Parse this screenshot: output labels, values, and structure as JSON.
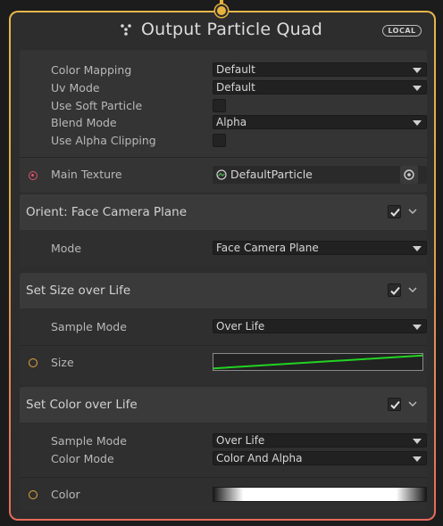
{
  "node": {
    "title": "Output Particle Quad",
    "badge": "LOCAL",
    "icon": "vfx-output-icon",
    "accent_color": "#e6b33e"
  },
  "main": {
    "properties": [
      {
        "label": "Color Mapping",
        "type": "dropdown",
        "value": "Default"
      },
      {
        "label": "Uv Mode",
        "type": "dropdown",
        "value": "Default"
      },
      {
        "label": "Use Soft Particle",
        "type": "checkbox",
        "checked": false
      },
      {
        "label": "Blend Mode",
        "type": "dropdown",
        "value": "Alpha"
      },
      {
        "label": "Use Alpha Clipping",
        "type": "checkbox",
        "checked": false
      }
    ],
    "main_texture": {
      "label": "Main Texture",
      "value": "DefaultParticle"
    }
  },
  "blocks": [
    {
      "title": "Orient: Face Camera Plane",
      "enabled": true,
      "settings": [
        {
          "label": "Mode",
          "value": "Face Camera Plane"
        }
      ]
    },
    {
      "title": "Set Size over Life",
      "enabled": true,
      "settings": [
        {
          "label": "Sample Mode",
          "value": "Over Life"
        }
      ],
      "input": {
        "label": "Size",
        "curve_color": "#22d322",
        "curve_start": 0.1,
        "curve_end": 0.9
      }
    },
    {
      "title": "Set Color over Life",
      "enabled": true,
      "settings": [
        {
          "label": "Sample Mode",
          "value": "Over Life"
        },
        {
          "label": "Color Mode",
          "value": "Color And Alpha"
        }
      ],
      "input": {
        "label": "Color"
      }
    }
  ],
  "colors": {
    "port_orange": "#e5a83c",
    "port_pink": "#e0546d",
    "border_gradient_top": "#e8b74a",
    "border_gradient_bottom": "#e86a5b"
  }
}
